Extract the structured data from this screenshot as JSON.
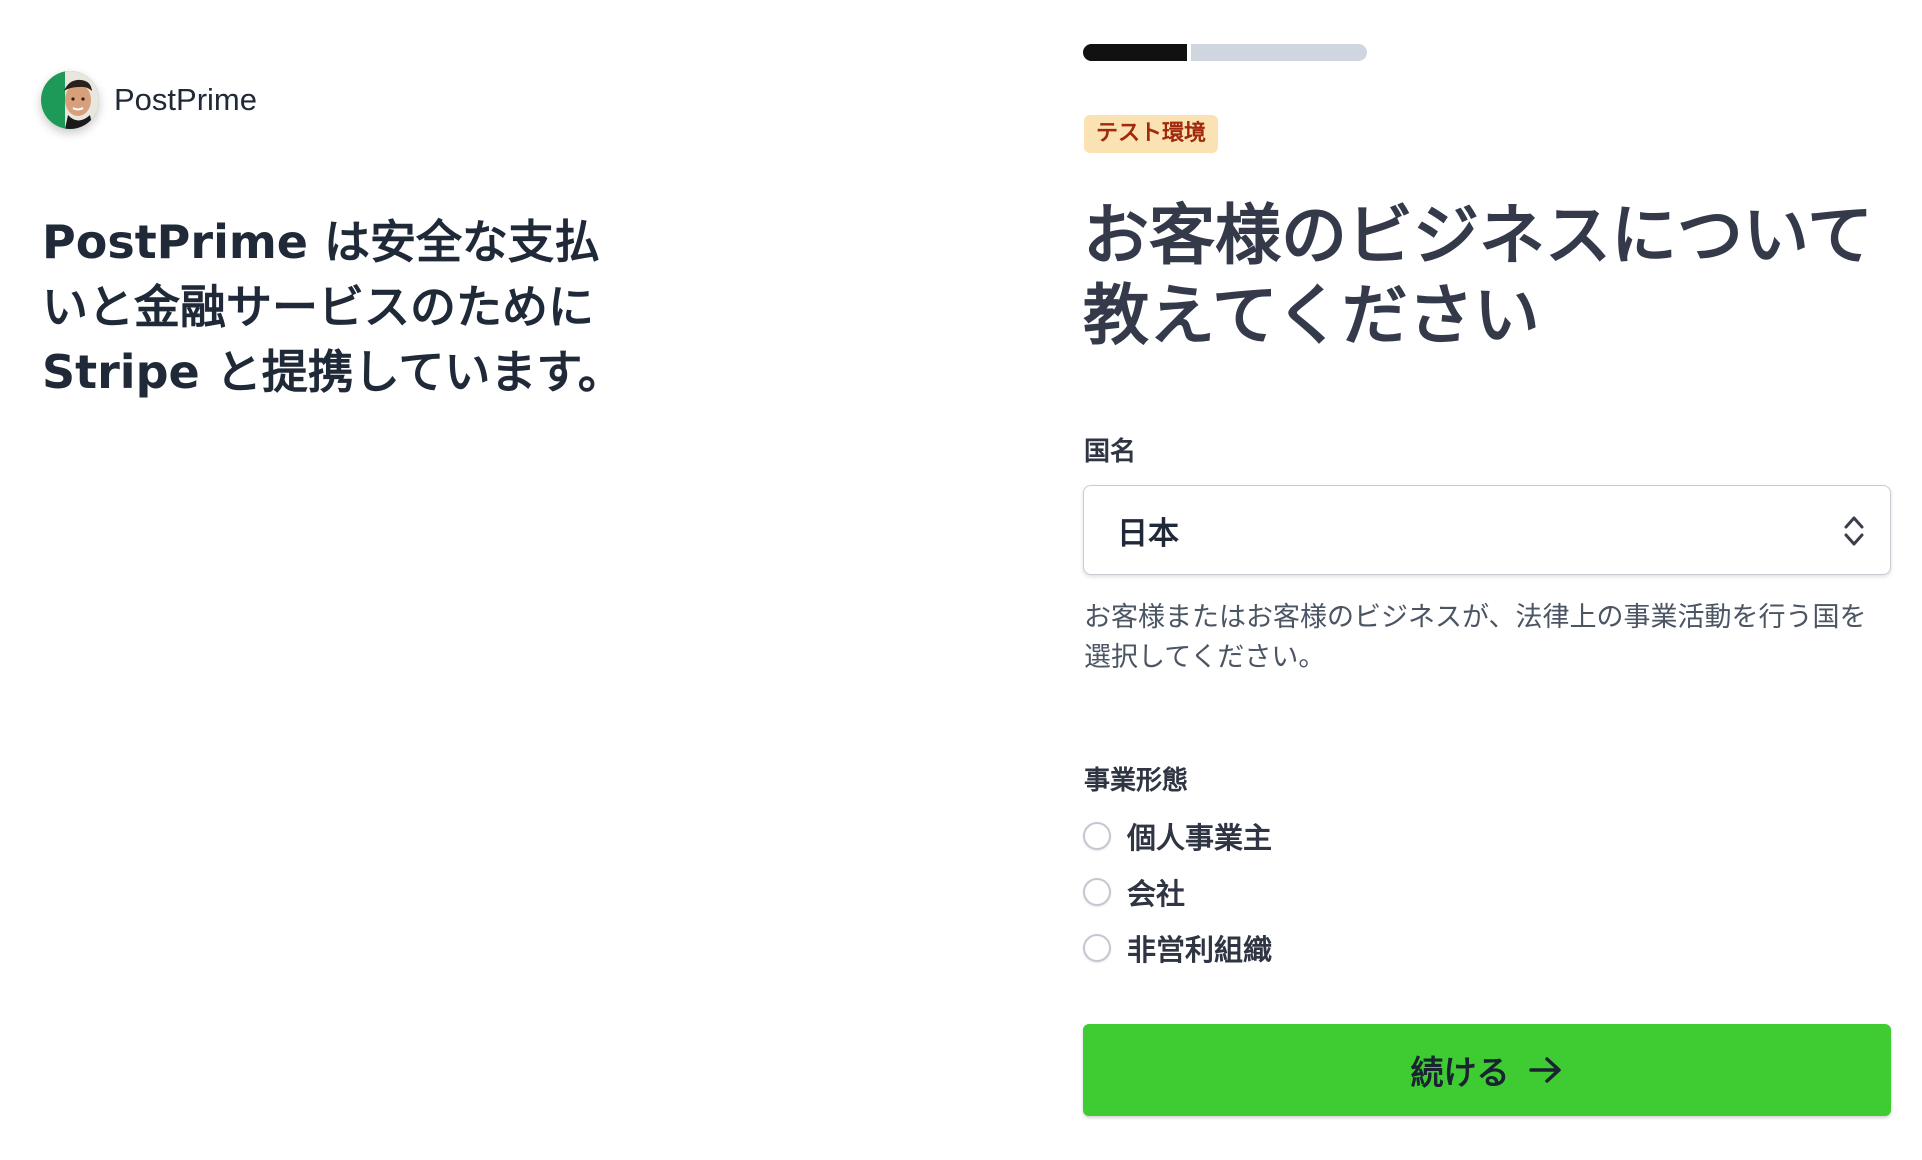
{
  "brand": {
    "name": "PostPrime",
    "tagline": "PostPrime は安全な支払いと金融サービスのためにStripe と提携しています。"
  },
  "progress": {
    "value": 0.38
  },
  "badge": {
    "label": "テスト環境"
  },
  "heading": "お客様のビジネスについて教えてください",
  "country": {
    "label": "国名",
    "value": "日本",
    "help": "お客様またはお客様のビジネスが、法律上の事業活動を行う国を選択してください。"
  },
  "business_type": {
    "label": "事業形態",
    "options": [
      {
        "label": "個人事業主",
        "selected": false
      },
      {
        "label": "会社",
        "selected": false
      },
      {
        "label": "非営利組織",
        "selected": false
      }
    ]
  },
  "continue_button": {
    "label": "続ける",
    "icon": "arrow-right-icon",
    "color": "#3fcc32"
  },
  "colors": {
    "badge_bg": "#fbe2b2",
    "badge_text": "#a1290c",
    "progress_fill": "#111111",
    "progress_track": "#cfd6e0"
  }
}
